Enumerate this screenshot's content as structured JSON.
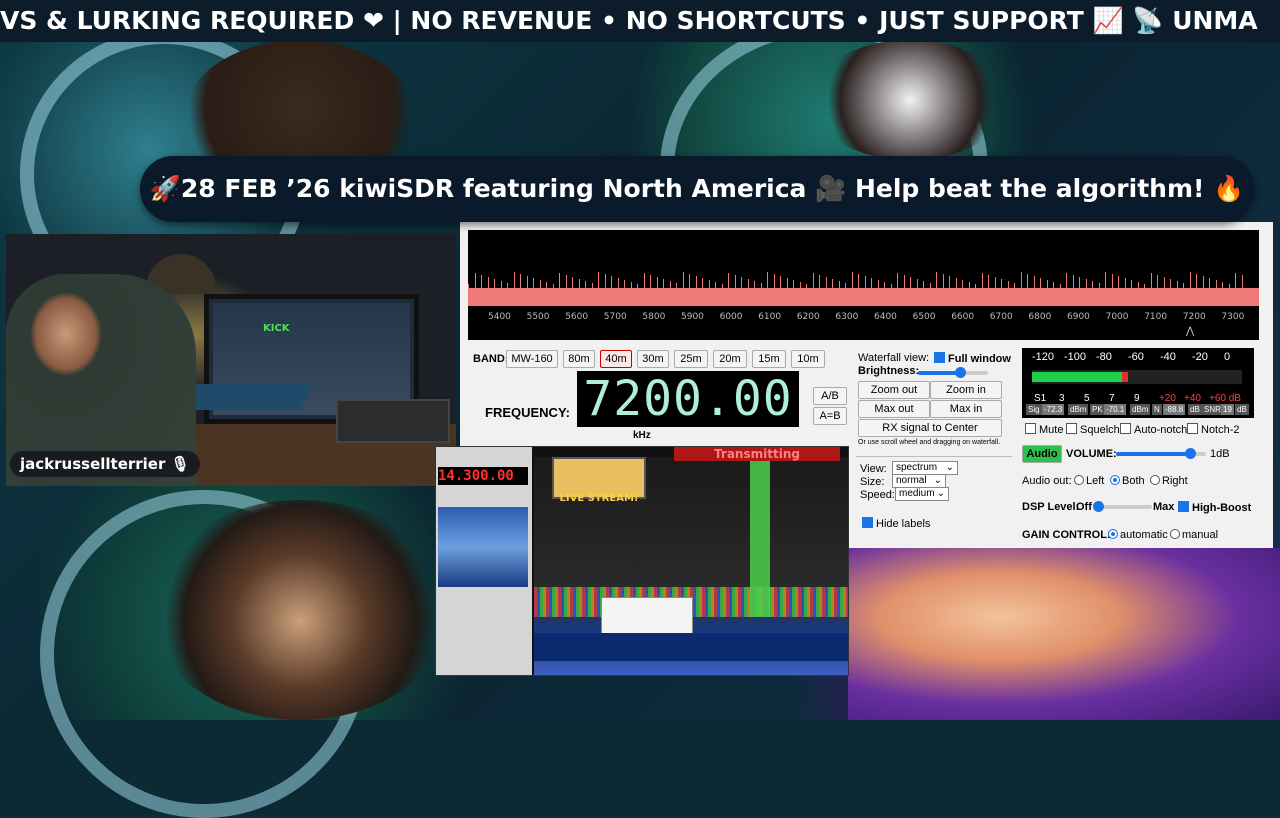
{
  "ticker": {
    "text": "VS & LURKING REQUIRED ❤ | NO REVENUE • NO SHORTCUTS • JUST SUPPORT 📈        📡 UNMA"
  },
  "banner": {
    "text": "🚀28 FEB ’26 kiwiSDR featuring North America 🎥 Help beat the algorithm! 🔥"
  },
  "webcam": {
    "username": "jackrussellterrier",
    "screen_text": "KICK"
  },
  "sdr": {
    "spectrum_axis": [
      "5400",
      "5500",
      "5600",
      "5700",
      "5800",
      "5900",
      "6000",
      "6100",
      "6200",
      "6300",
      "6400",
      "6500",
      "6600",
      "6700",
      "6800",
      "6900",
      "7000",
      "7100",
      "7200",
      "7300"
    ],
    "band_label": "BAND:",
    "bands": [
      {
        "label": "MW-160",
        "active": false
      },
      {
        "label": "80m",
        "active": false
      },
      {
        "label": "40m",
        "active": true
      },
      {
        "label": "30m",
        "active": false
      },
      {
        "label": "25m",
        "active": false
      },
      {
        "label": "20m",
        "active": false
      },
      {
        "label": "15m",
        "active": false
      },
      {
        "label": "10m",
        "active": false
      }
    ],
    "frequency_label": "FREQUENCY:",
    "frequency_value": "7200.00",
    "frequency_unit": "kHz",
    "ab_label": "A/B",
    "aeqb_label": "A=B",
    "waterfall_view_label": "Waterfall view:",
    "full_window_label": "Full window",
    "full_window_checked": true,
    "brightness_label": "Brightness:",
    "brightness_level": 0.6,
    "zoom_out": "Zoom out",
    "zoom_in": "Zoom in",
    "max_out": "Max out",
    "max_in": "Max in",
    "rx_center": "RX signal to Center",
    "hint": "Or use scroll wheel and dragging on waterfall.",
    "view_label": "View:",
    "view_value": "spectrum",
    "size_label": "Size:",
    "size_value": "normal",
    "speed_label": "Speed:",
    "speed_value": "medium",
    "hide_labels": "Hide labels",
    "hide_labels_checked": true,
    "smeter_scale": [
      "-120",
      "-100",
      "-80",
      "-60",
      "-40",
      "-20",
      "0"
    ],
    "smeter_s": [
      "S1",
      "3",
      "5",
      "7",
      "9",
      "+20",
      "+40",
      "+60 dB"
    ],
    "smeter_sig_label": "Sig",
    "smeter_sig": "-72.3",
    "smeter_unit": "dBm",
    "smeter_pk_label": "PK",
    "smeter_pk": "-70.1",
    "smeter_n_label": "N",
    "smeter_n": "-88.8",
    "smeter_db": "dB",
    "smeter_snr_label": "SNR",
    "smeter_snr": "19",
    "mute": "Mute",
    "squelch": "Squelch",
    "autonotch": "Auto-notch",
    "notch2": "Notch-2",
    "audio_btn": "Audio",
    "volume_label": "VOLUME:",
    "volume_level": 0.82,
    "volume_db": "1dB",
    "audio_out_label": "Audio out:",
    "audio_left": "Left",
    "audio_both": "Both",
    "audio_right": "Right",
    "dsp_label": "DSP Level:",
    "dsp_off": "Off",
    "dsp_max": "Max",
    "high_boost": "High-Boost",
    "gain_label": "GAIN CONTROL:",
    "gain_auto": "automatic",
    "gain_manual": "manual"
  },
  "overlay": {
    "freq": "14.300.00",
    "transmitting": "Transmitting",
    "live_stream": "LIVE STREAM!"
  }
}
